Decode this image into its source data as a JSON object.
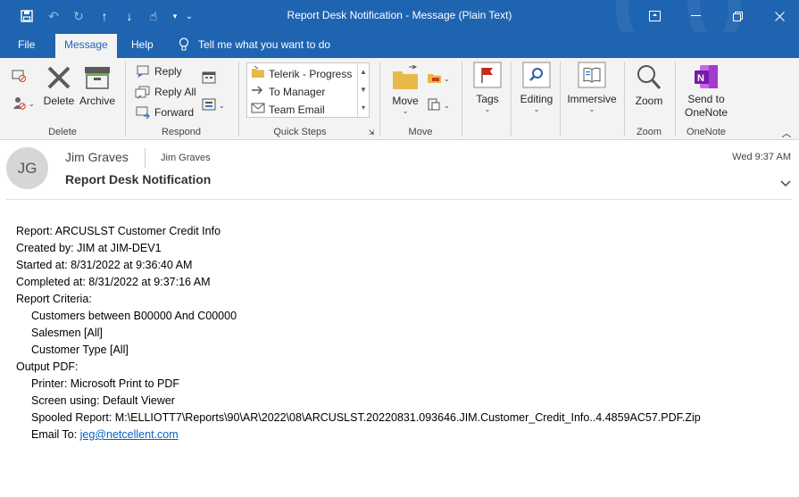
{
  "window": {
    "title": "Report Desk Notification  -  Message (Plain Text)"
  },
  "menu_tabs": [
    "File",
    "Message",
    "Help"
  ],
  "tell_me": "Tell me what you want to do",
  "ribbon": {
    "delete_group": {
      "label": "Delete",
      "delete": "Delete",
      "archive": "Archive"
    },
    "respond_group": {
      "label": "Respond",
      "reply": "Reply",
      "reply_all": "Reply All",
      "forward": "Forward"
    },
    "quick_steps_group": {
      "label": "Quick Steps",
      "items": [
        "Telerik - Progress",
        "To Manager",
        "Team Email"
      ]
    },
    "move_group": {
      "label": "Move",
      "move": "Move"
    },
    "tags": "Tags",
    "editing": "Editing",
    "immersive": "Immersive",
    "zoom_group": {
      "label": "Zoom",
      "zoom": "Zoom"
    },
    "onenote_group": {
      "label": "OneNote",
      "send_line1": "Send to",
      "send_line2": "OneNote"
    }
  },
  "message": {
    "avatar_initials": "JG",
    "sender": "Jim Graves",
    "to": "Jim Graves",
    "subject": "Report Desk Notification",
    "date": "Wed 9:37 AM",
    "lines": {
      "report": "Report: ARCUSLST  Customer Credit Info",
      "created": "Created by: JIM at JIM-DEV1",
      "started": "Started at: 8/31/2022 at 9:36:40 AM",
      "completed": "Completed at: 8/31/2022 at 9:37:16 AM",
      "criteria": "Report Criteria:",
      "crit_customers": "Customers between B00000 And C00000",
      "crit_salesmen": "Salesmen  [All]",
      "crit_type": "Customer Type  [All]",
      "output": "Output PDF:",
      "printer": "Printer: Microsoft Print to PDF",
      "screen": "Screen using: Default Viewer",
      "spooled": "Spooled Report: M:\\ELLIOTT7\\Reports\\90\\AR\\2022\\08\\ARCUSLST.20220831.093646.JIM.Customer_Credit_Info..4.4859AC57.PDF.Zip",
      "email_label": "Email To: ",
      "email": "jeg@netcellent.com"
    }
  },
  "colors": {
    "title_bar": "#1f64b1",
    "ribbon_bg": "#f3f3f3",
    "link": "#0563c1",
    "onenote": "#7719aa",
    "tags_flag": "#c42b1c"
  }
}
